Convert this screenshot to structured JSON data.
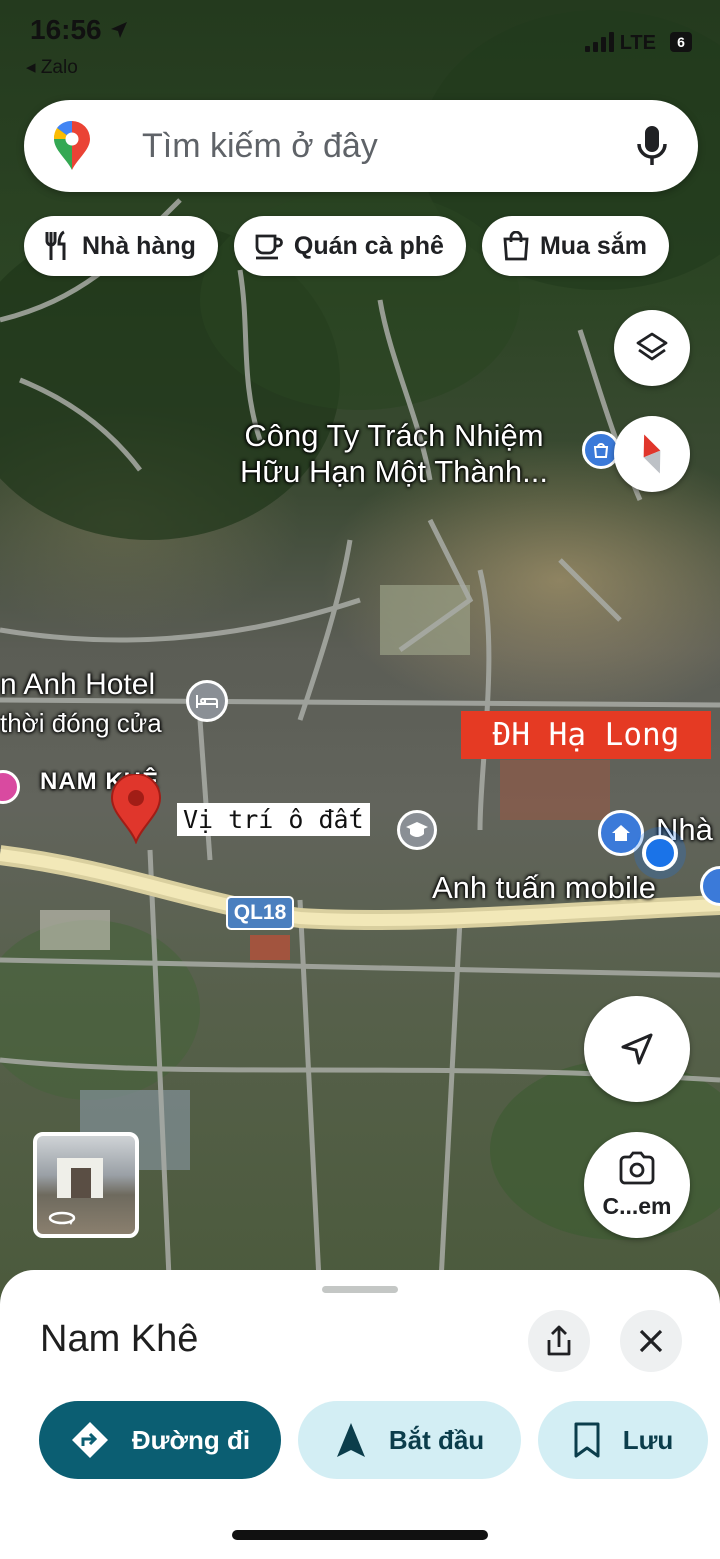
{
  "status_bar": {
    "time": "16:56",
    "back_app": "Zalo",
    "network": "LTE",
    "battery": "6"
  },
  "search": {
    "placeholder": "Tìm kiếm ở đây"
  },
  "chips": [
    {
      "label": "Nhà hàng",
      "icon": "restaurant-icon"
    },
    {
      "label": "Quán cà phê",
      "icon": "coffee-icon"
    },
    {
      "label": "Mua sắm",
      "icon": "shopping-bag-icon"
    }
  ],
  "map": {
    "labels": {
      "company_line1": "Công Ty Trách Nhiệm",
      "company_line2": "Hữu Hạn Một Thành...",
      "hotel": "n Anh Hotel",
      "hotel_status": "thời đóng cửa",
      "area": "NAM KHÊ",
      "plot": "Vị trí ô đất",
      "university": "ĐH Hạ Long",
      "mobile_shop": "Anh tuấn mobile",
      "nha": "Nhà",
      "road": "QL18"
    },
    "camera_button": "C...em"
  },
  "sheet": {
    "title": "Nam Khê",
    "actions": {
      "directions": "Đường đi",
      "start": "Bắt đầu",
      "save": "Lưu"
    }
  },
  "colors": {
    "primary_teal": "#0b5e72",
    "light_teal": "#d3eef4",
    "pin_red": "#e0362c",
    "university_label_bg": "#e53a23",
    "road_shield": "#4a7fbf"
  }
}
